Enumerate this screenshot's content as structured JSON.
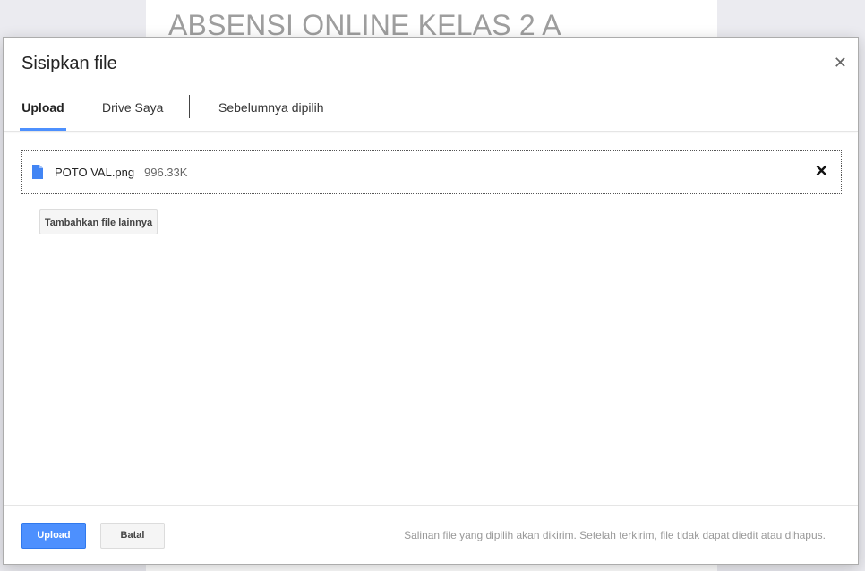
{
  "background": {
    "title": "ABSENSI ONLINE KELAS 2 A"
  },
  "dialog": {
    "title": "Sisipkan file",
    "close_icon": "close-icon",
    "tabs": [
      {
        "label": "Upload",
        "active": true
      },
      {
        "label": "Drive Saya",
        "active": false
      },
      {
        "label": "Sebelumnya dipilih",
        "active": false
      }
    ],
    "file": {
      "name": "POTO VAL.png",
      "size": "996.33K",
      "icon": "file-document-icon",
      "remove_icon": "remove-x-icon"
    },
    "add_more_label": "Tambahkan file lainnya",
    "footer": {
      "upload_label": "Upload",
      "cancel_label": "Batal",
      "note": "Salinan file yang dipilih akan dikirim. Setelah terkirim, file tidak dapat diedit atau dihapus."
    }
  },
  "colors": {
    "accent": "#4d90fe",
    "file_icon": "#4285f4"
  }
}
